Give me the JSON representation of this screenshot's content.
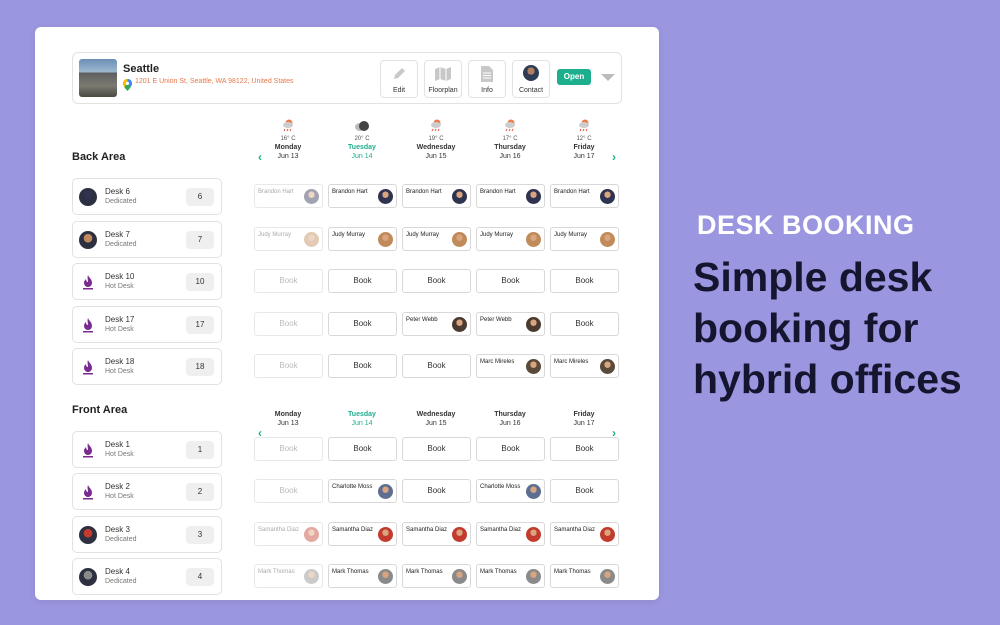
{
  "location": {
    "name": "Seattle",
    "address": "1201 E Union St, Seattle, WA 98122, United States",
    "status": "Open"
  },
  "header_buttons": [
    {
      "label": "Edit",
      "icon": "pencil-icon"
    },
    {
      "label": "Floorplan",
      "icon": "map-icon"
    },
    {
      "label": "Info",
      "icon": "document-icon"
    },
    {
      "label": "Contact",
      "icon": "contact-avatar"
    }
  ],
  "weather": [
    {
      "temp": "16° C",
      "icon": "rain-cloud-icon"
    },
    {
      "temp": "20° C",
      "icon": "cloud-icon"
    },
    {
      "temp": "19° C",
      "icon": "rain-cloud-icon"
    },
    {
      "temp": "17° C",
      "icon": "rain-cloud-icon"
    },
    {
      "temp": "12° C",
      "icon": "rain-cloud-icon"
    }
  ],
  "days": [
    {
      "name": "Monday",
      "date": "Jun 13",
      "today": false
    },
    {
      "name": "Tuesday",
      "date": "Jun 14",
      "today": true
    },
    {
      "name": "Wednesday",
      "date": "Jun 15",
      "today": false
    },
    {
      "name": "Thursday",
      "date": "Jun 16",
      "today": false
    },
    {
      "name": "Friday",
      "date": "Jun 17",
      "today": false
    }
  ],
  "book_label": "Book",
  "areas": [
    {
      "title": "Back Area",
      "desks": [
        {
          "name": "Desk 6",
          "type": "Dedicated",
          "number": "6",
          "cells": [
            {
              "person": "Brandon Hart",
              "av": "#2f3350"
            },
            {
              "person": "Brandon Hart",
              "av": "#2f3350"
            },
            {
              "person": "Brandon Hart",
              "av": "#2f3350"
            },
            {
              "person": "Brandon Hart",
              "av": "#2f3350"
            },
            {
              "person": "Brandon Hart",
              "av": "#2f3350"
            }
          ]
        },
        {
          "name": "Desk 7",
          "type": "Dedicated",
          "number": "7",
          "cells": [
            {
              "person": "Judy Murray",
              "av": "#c08a5a"
            },
            {
              "person": "Judy Murray",
              "av": "#c08a5a"
            },
            {
              "person": "Judy Murray",
              "av": "#c08a5a"
            },
            {
              "person": "Judy Murray",
              "av": "#c08a5a"
            },
            {
              "person": "Judy Murray",
              "av": "#c08a5a"
            }
          ]
        },
        {
          "name": "Desk 10",
          "type": "Hot Desk",
          "number": "10",
          "cells": [
            {
              "book": true
            },
            {
              "book": true
            },
            {
              "book": true
            },
            {
              "book": true
            },
            {
              "book": true
            }
          ]
        },
        {
          "name": "Desk 17",
          "type": "Hot Desk",
          "number": "17",
          "cells": [
            {
              "book": true
            },
            {
              "book": true
            },
            {
              "person": "Peter Webb",
              "av": "#4a3a30"
            },
            {
              "person": "Peter Webb",
              "av": "#4a3a30"
            },
            {
              "book": true
            }
          ]
        },
        {
          "name": "Desk 18",
          "type": "Hot Desk",
          "number": "18",
          "cells": [
            {
              "book": true
            },
            {
              "book": true
            },
            {
              "book": true
            },
            {
              "person": "Marc Mireles",
              "av": "#5a4a3a"
            },
            {
              "person": "Marc Mireles",
              "av": "#5a4a3a"
            }
          ]
        }
      ]
    },
    {
      "title": "Front Area",
      "desks": [
        {
          "name": "Desk 1",
          "type": "Hot Desk",
          "number": "1",
          "cells": [
            {
              "book": true
            },
            {
              "book": true
            },
            {
              "book": true
            },
            {
              "book": true
            },
            {
              "book": true
            }
          ]
        },
        {
          "name": "Desk 2",
          "type": "Hot Desk",
          "number": "2",
          "cells": [
            {
              "book": true
            },
            {
              "person": "Charlotte Moss",
              "av": "#5d6e90"
            },
            {
              "book": true
            },
            {
              "person": "Charlotte Moss",
              "av": "#5d6e90"
            },
            {
              "book": true
            }
          ]
        },
        {
          "name": "Desk 3",
          "type": "Dedicated",
          "number": "3",
          "cells": [
            {
              "person": "Samantha Diaz",
              "av": "#c23b2e"
            },
            {
              "person": "Samantha Diaz",
              "av": "#c23b2e"
            },
            {
              "person": "Samantha Diaz",
              "av": "#c23b2e"
            },
            {
              "person": "Samantha Diaz",
              "av": "#c23b2e"
            },
            {
              "person": "Samantha Diaz",
              "av": "#c23b2e"
            }
          ]
        },
        {
          "name": "Desk 4",
          "type": "Dedicated",
          "number": "4",
          "cells": [
            {
              "person": "Mark Thomas",
              "av": "#8a8a8a"
            },
            {
              "person": "Mark Thomas",
              "av": "#8a8a8a"
            },
            {
              "person": "Mark Thomas",
              "av": "#8a8a8a"
            },
            {
              "person": "Mark Thomas",
              "av": "#8a8a8a"
            },
            {
              "person": "Mark Thomas",
              "av": "#8a8a8a"
            }
          ]
        }
      ]
    }
  ],
  "hero": {
    "kicker": "DESK BOOKING",
    "title": "Simple desk booking for hybrid offices"
  },
  "colors": {
    "accent": "#1dae8e",
    "background": "#9b96e0",
    "address": "#e6784a"
  }
}
